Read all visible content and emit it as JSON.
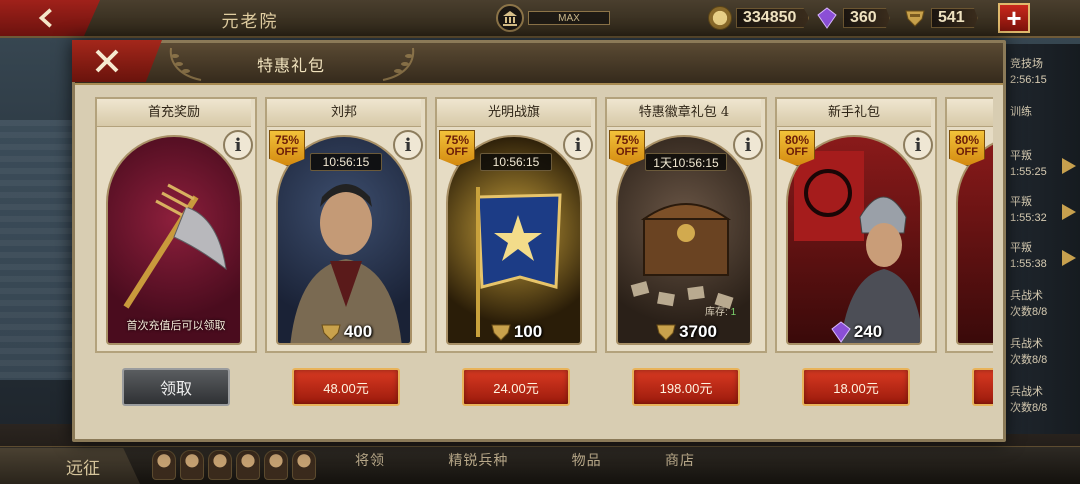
{
  "header": {
    "title": "元老院",
    "max_label": "MAX",
    "resources": [
      {
        "name": "coins",
        "icon": "coin-icon",
        "value": "334850"
      },
      {
        "name": "gems",
        "icon": "gem-icon",
        "value": "360"
      },
      {
        "name": "medals",
        "icon": "medal-icon",
        "value": "541"
      }
    ],
    "plus_label": "+"
  },
  "modal": {
    "title": "特惠礼包",
    "cards": [
      {
        "title": "首充奖励",
        "caption": "首次充值后可以领取",
        "button": "领取",
        "type": "claim",
        "art": "axe"
      },
      {
        "title": "刘邦",
        "off_pct": "75%",
        "off_label": "OFF",
        "timer": "10:56:15",
        "amount": "400",
        "amount_icon": "medal-icon",
        "button": "48.00元",
        "art": "general"
      },
      {
        "title": "光明战旗",
        "off_pct": "75%",
        "off_label": "OFF",
        "timer": "10:56:15",
        "amount": "100",
        "amount_icon": "medal-icon",
        "button": "24.00元",
        "art": "banner"
      },
      {
        "title": "特惠徽章礼包 4",
        "off_pct": "75%",
        "off_label": "OFF",
        "timer": "1天10:56:15",
        "amount": "3700",
        "amount_icon": "medal-icon",
        "stock_label": "库存:",
        "stock_value": "1",
        "button": "198.00元",
        "art": "chest"
      },
      {
        "title": "新手礼包",
        "off_pct": "80%",
        "off_label": "OFF",
        "amount": "240",
        "amount_icon": "gem-icon",
        "button": "18.00元",
        "art": "warrior"
      },
      {
        "title": "",
        "off_pct": "80%",
        "off_label": "OFF",
        "art": "partial"
      }
    ]
  },
  "side": [
    {
      "line1": "竞技场",
      "line2": "2:56:15"
    },
    {
      "line1": "训练",
      "line2": ""
    },
    {
      "line1": "平叛",
      "line2": "1:55:25"
    },
    {
      "line1": "平叛",
      "line2": "1:55:32"
    },
    {
      "line1": "平叛",
      "line2": "1:55:38"
    },
    {
      "line1": "兵战术",
      "line2": "次数8/8"
    },
    {
      "line1": "兵战术",
      "line2": "次数8/8"
    },
    {
      "line1": "兵战术",
      "line2": "次数8/8"
    }
  ],
  "bottom": {
    "expedition": "远征",
    "tabs": [
      "将领",
      "精锐兵种",
      "物品",
      "商店"
    ]
  },
  "colors": {
    "accent_red": "#a4271b",
    "gold": "#e9b35a",
    "parchment": "#d8cdb2"
  }
}
